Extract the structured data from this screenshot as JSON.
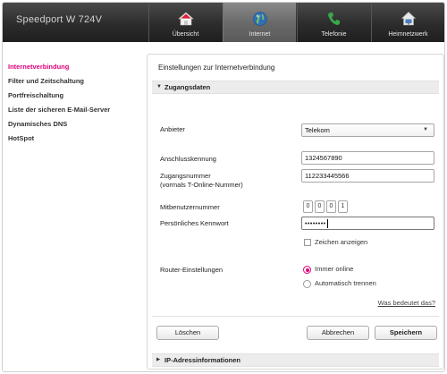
{
  "header": {
    "brand": "Speedport W 724V",
    "tabs": [
      {
        "label": "Übersicht",
        "icon": "house-icon"
      },
      {
        "label": "Internet",
        "icon": "globe-icon"
      },
      {
        "label": "Telefonie",
        "icon": "phone-icon"
      },
      {
        "label": "Heimnetzwerk",
        "icon": "home-network-icon"
      }
    ],
    "active_tab": "Internet"
  },
  "sidebar": {
    "items": [
      {
        "label": "Internetverbindung",
        "active": true
      },
      {
        "label": "Filter und Zeitschaltung"
      },
      {
        "label": "Portfreischaltung"
      },
      {
        "label": "Liste der sicheren E-Mail-Server"
      },
      {
        "label": "Dynamisches DNS"
      },
      {
        "label": "HotSpot"
      }
    ]
  },
  "main": {
    "title": "Einstellungen zur Internetverbindung",
    "section_zugangsdaten": "Zugangsdaten",
    "anbieter_label": "Anbieter",
    "anbieter_value": "Telekom",
    "anschlusskennung_label": "Anschlusskennung",
    "anschlusskennung_value": "1324567890",
    "zugangsnummer_label": "Zugangsnummer",
    "zugangsnummer_sub": "(vormals T-Online-Nummer)",
    "zugangsnummer_value": "112233445566",
    "mitbenutzer_label": "Mitbenutzernummer",
    "mitbenutzer_digits": [
      "0",
      "0",
      "0",
      "1"
    ],
    "kennwort_label": "Persönliches Kennwort",
    "kennwort_value": "••••••••",
    "zeichen_label": "Zeichen anzeigen",
    "router_label": "Router-Einstellungen",
    "radio_immer": "Immer online",
    "radio_auto": "Automatisch trennen",
    "help_link": "Was bedeutet das?",
    "btn_loeschen": "Löschen",
    "btn_abbrechen": "Abbrechen",
    "btn_speichern": "Speichern",
    "section_ip": "IP-Adressinformationen"
  },
  "colors": {
    "accent": "#e2007a",
    "header_dark": "#2c2c2c",
    "active_tab": "#6a6a6a",
    "phone_green": "#3aa84a",
    "globe_blue": "#2e6fb7"
  }
}
